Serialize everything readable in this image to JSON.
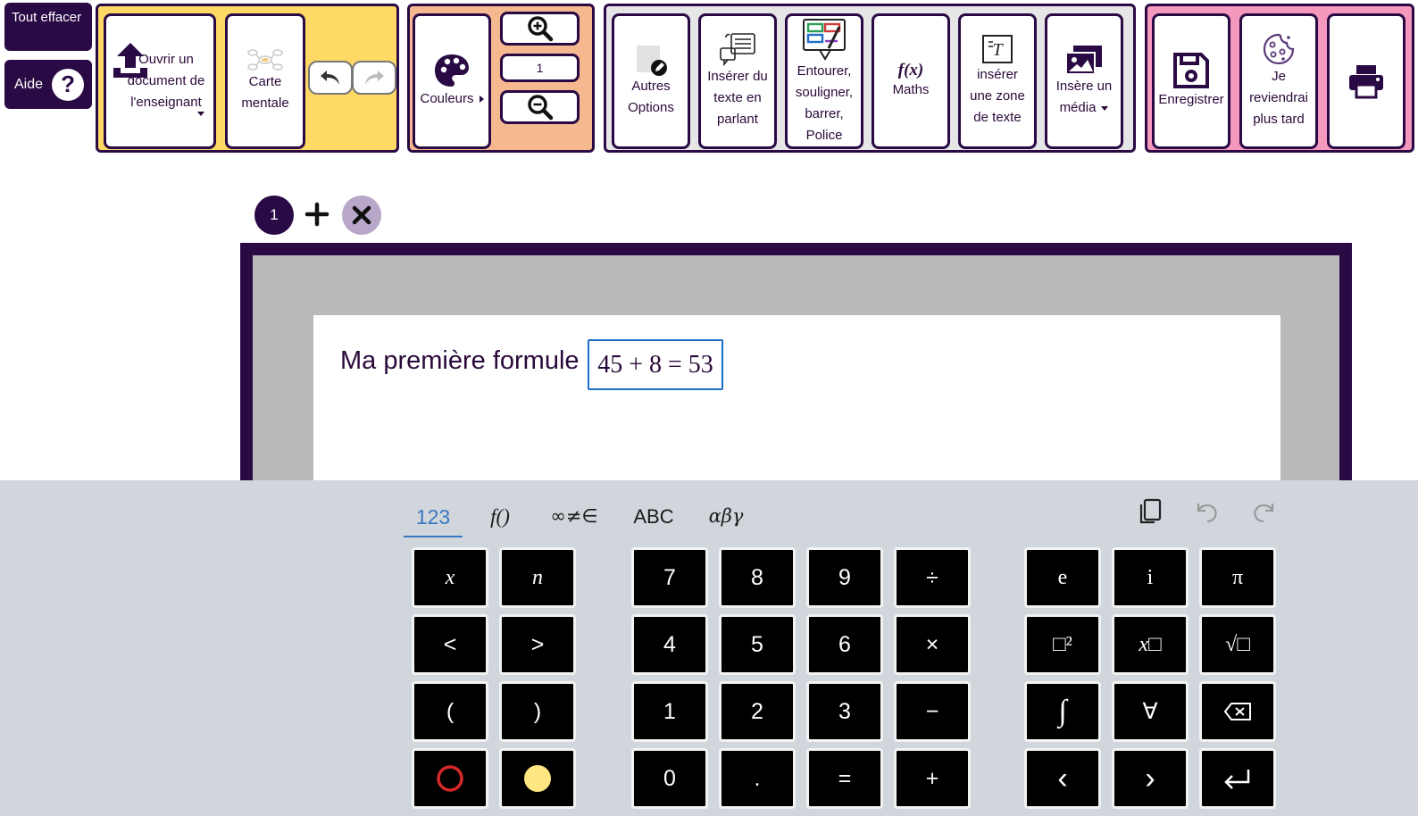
{
  "left_buttons": {
    "clear_all": "Tout effacer",
    "help": "Aide",
    "help_symbol": "?"
  },
  "toolbar": {
    "open_doc": "Ouvrir un\ndocument de\nl'enseignant",
    "mind_map": "Carte\nmentale",
    "colors": "Couleurs",
    "zoom_level": "1",
    "other_options": "Autres\nOptions",
    "speech_text": "Insérer du\ntexte en\nparlant",
    "circle_underline": "Entourer,\nsouligner,\nbarrer,\nPolice",
    "maths": "Maths",
    "maths_icon_text": "f(x)",
    "text_zone": "insérer\nune zone\nde texte",
    "insert_media": "Insère un\nmédia",
    "save": "Enregistrer",
    "later": "Je\nreviendrai\nplus tard"
  },
  "icons": [
    "upload-icon",
    "mind-map-icon",
    "undo-icon",
    "redo-icon",
    "palette-icon",
    "zoom-in-icon",
    "zoom-out-icon",
    "edit-icon",
    "speech-to-text-icon",
    "highlight-icon",
    "text-zone-icon",
    "media-icon",
    "save-icon",
    "cookie-icon",
    "print-icon",
    "copy-icon",
    "keyboard-undo-icon",
    "keyboard-redo-icon",
    "backspace-icon",
    "enter-icon"
  ],
  "pages": {
    "current": "1",
    "add_symbol": "+",
    "delete_symbol": "✕"
  },
  "document": {
    "text": "Ma première formule",
    "formula": "45 + 8 = 53"
  },
  "keyboard": {
    "tabs": {
      "numbers": "123",
      "functions": "f()",
      "symbols": "∞≠∈",
      "letters": "ABC",
      "greek": "αβγ"
    },
    "active_tab": "123",
    "keys": {
      "x": "x",
      "n": "n",
      "lt": "<",
      "gt": ">",
      "lparen": "(",
      "rparen": ")",
      "k7": "7",
      "k8": "8",
      "k9": "9",
      "div": "÷",
      "k4": "4",
      "k5": "5",
      "k6": "6",
      "mul": "×",
      "k1": "1",
      "k2": "2",
      "k3": "3",
      "minus": "−",
      "k0": "0",
      "dot": ".",
      "eq": "=",
      "plus": "+",
      "e": "e",
      "i": "i",
      "pi": "π",
      "square": "□²",
      "power": "x□",
      "sqrt": "√□",
      "integral": "∫",
      "forall": "∀",
      "left": "‹",
      "right": "›"
    },
    "colors": {
      "red_circle": "#d62828",
      "yellow_dot": "#ffe680"
    }
  },
  "colors": {
    "primary": "#2a0a45",
    "yellow_group": "#ffd966",
    "orange_group": "#f6b88f",
    "grey_group": "#e6e6e6",
    "pink_group": "#f598bd",
    "formula_border": "#1e6fc8"
  }
}
